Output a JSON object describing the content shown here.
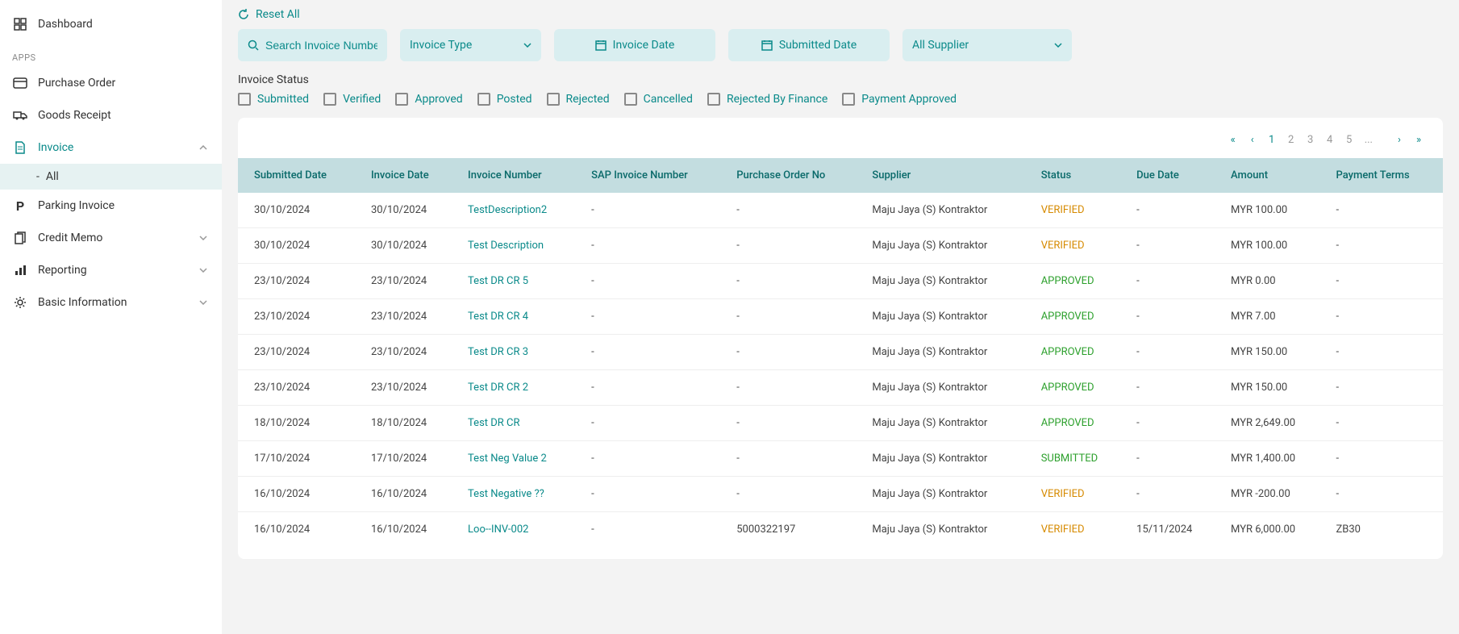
{
  "sidebar": {
    "dashboard": "Dashboard",
    "apps_label": "APPS",
    "items": [
      {
        "label": "Purchase Order"
      },
      {
        "label": "Goods Receipt"
      },
      {
        "label": "Invoice"
      },
      {
        "label": "Parking Invoice"
      },
      {
        "label": "Credit Memo"
      },
      {
        "label": "Reporting"
      },
      {
        "label": "Basic Information"
      }
    ],
    "invoice_sub_dash": "-",
    "invoice_sub": "All"
  },
  "reset": "Reset All",
  "filters": {
    "search_placeholder": "Search Invoice Number",
    "type": "Invoice Type",
    "invoice_date": "Invoice Date",
    "submitted_date": "Submitted Date",
    "supplier": "All Supplier"
  },
  "status": {
    "title": "Invoice Status",
    "options": [
      "Submitted",
      "Verified",
      "Approved",
      "Posted",
      "Rejected",
      "Cancelled",
      "Rejected By Finance",
      "Payment Approved"
    ]
  },
  "pagination": {
    "pages": [
      "1",
      "2",
      "3",
      "4",
      "5",
      "..."
    ]
  },
  "table": {
    "headers": [
      "Submitted Date",
      "Invoice Date",
      "Invoice Number",
      "SAP Invoice Number",
      "Purchase Order No",
      "Supplier",
      "Status",
      "Due Date",
      "Amount",
      "Payment Terms"
    ],
    "rows": [
      {
        "submitted": "30/10/2024",
        "invoice_date": "30/10/2024",
        "invnum": "TestDescription2",
        "sap": "-",
        "po": "-",
        "supplier": "Maju Jaya (S) Kontraktor",
        "status": "VERIFIED",
        "due": "-",
        "amount": "MYR 100.00",
        "terms": "-"
      },
      {
        "submitted": "30/10/2024",
        "invoice_date": "30/10/2024",
        "invnum": "Test Description",
        "sap": "-",
        "po": "-",
        "supplier": "Maju Jaya (S) Kontraktor",
        "status": "VERIFIED",
        "due": "-",
        "amount": "MYR 100.00",
        "terms": "-"
      },
      {
        "submitted": "23/10/2024",
        "invoice_date": "23/10/2024",
        "invnum": "Test DR CR 5",
        "sap": "-",
        "po": "-",
        "supplier": "Maju Jaya (S) Kontraktor",
        "status": "APPROVED",
        "due": "-",
        "amount": "MYR 0.00",
        "terms": "-"
      },
      {
        "submitted": "23/10/2024",
        "invoice_date": "23/10/2024",
        "invnum": "Test DR CR 4",
        "sap": "-",
        "po": "-",
        "supplier": "Maju Jaya (S) Kontraktor",
        "status": "APPROVED",
        "due": "-",
        "amount": "MYR 7.00",
        "terms": "-"
      },
      {
        "submitted": "23/10/2024",
        "invoice_date": "23/10/2024",
        "invnum": "Test DR CR 3",
        "sap": "-",
        "po": "-",
        "supplier": "Maju Jaya (S) Kontraktor",
        "status": "APPROVED",
        "due": "-",
        "amount": "MYR 150.00",
        "terms": "-"
      },
      {
        "submitted": "23/10/2024",
        "invoice_date": "23/10/2024",
        "invnum": "Test DR CR 2",
        "sap": "-",
        "po": "-",
        "supplier": "Maju Jaya (S) Kontraktor",
        "status": "APPROVED",
        "due": "-",
        "amount": "MYR 150.00",
        "terms": "-"
      },
      {
        "submitted": "18/10/2024",
        "invoice_date": "18/10/2024",
        "invnum": "Test DR CR",
        "sap": "-",
        "po": "-",
        "supplier": "Maju Jaya (S) Kontraktor",
        "status": "APPROVED",
        "due": "-",
        "amount": "MYR 2,649.00",
        "terms": "-"
      },
      {
        "submitted": "17/10/2024",
        "invoice_date": "17/10/2024",
        "invnum": "Test Neg Value 2",
        "sap": "-",
        "po": "-",
        "supplier": "Maju Jaya (S) Kontraktor",
        "status": "SUBMITTED",
        "due": "-",
        "amount": "MYR 1,400.00",
        "terms": "-"
      },
      {
        "submitted": "16/10/2024",
        "invoice_date": "16/10/2024",
        "invnum": "Test Negative ??",
        "sap": "-",
        "po": "-",
        "supplier": "Maju Jaya (S) Kontraktor",
        "status": "VERIFIED",
        "due": "-",
        "amount": "MYR -200.00",
        "terms": "-"
      },
      {
        "submitted": "16/10/2024",
        "invoice_date": "16/10/2024",
        "invnum": "Loo--INV-002",
        "sap": "-",
        "po": "5000322197",
        "supplier": "Maju Jaya (S) Kontraktor",
        "status": "VERIFIED",
        "due": "15/11/2024",
        "amount": "MYR 6,000.00",
        "terms": "ZB30"
      }
    ]
  }
}
